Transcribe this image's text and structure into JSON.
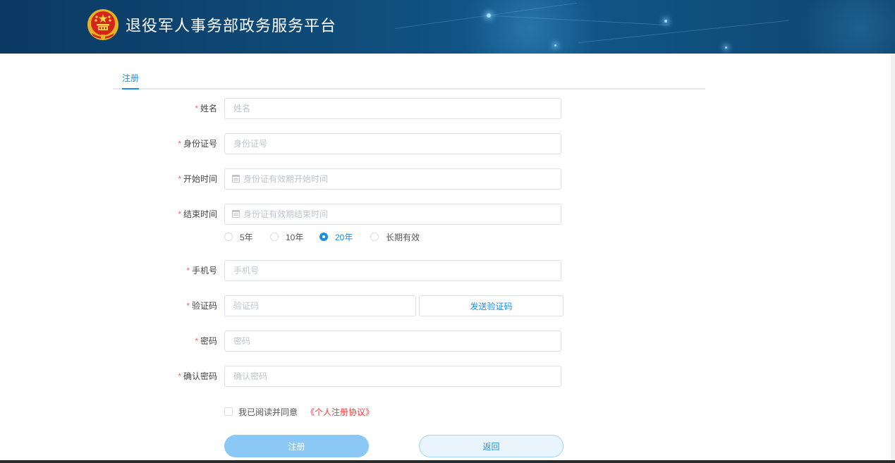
{
  "header": {
    "title": "退役军人事务部政务服务平台",
    "emblem_icon": "national-emblem-icon",
    "bg_color": "#0f4a78"
  },
  "tabs": [
    {
      "label": "注册",
      "active": true
    }
  ],
  "form": {
    "required_mark": "*",
    "name": {
      "label": "姓名",
      "placeholder": "姓名"
    },
    "id_number": {
      "label": "身份证号",
      "placeholder": "身份证号"
    },
    "start_time": {
      "label": "开始时间",
      "placeholder": "身份证有效期开始时间",
      "icon": "calendar-icon"
    },
    "end_time": {
      "label": "结束时间",
      "placeholder": "身份证有效期结束时间",
      "icon": "calendar-icon"
    },
    "validity_options": [
      {
        "label": "5年",
        "checked": false
      },
      {
        "label": "10年",
        "checked": false
      },
      {
        "label": "20年",
        "checked": true
      },
      {
        "label": "长期有效",
        "checked": false
      }
    ],
    "phone": {
      "label": "手机号",
      "placeholder": "手机号"
    },
    "code": {
      "label": "验证码",
      "placeholder": "验证码",
      "send_label": "发送验证码"
    },
    "password": {
      "label": "密码",
      "placeholder": "密码"
    },
    "confirm_password": {
      "label": "确认密码",
      "placeholder": "确认密码"
    },
    "agreement": {
      "text": "我已阅读并同意",
      "link": "《个人注册协议》",
      "checked": false
    },
    "register_label": "注册",
    "back_label": "返回"
  },
  "colors": {
    "accent": "#1a8fe3",
    "required": "#f56c6c",
    "link_red": "#f03a3a",
    "register_button": "#8cc8f5"
  }
}
